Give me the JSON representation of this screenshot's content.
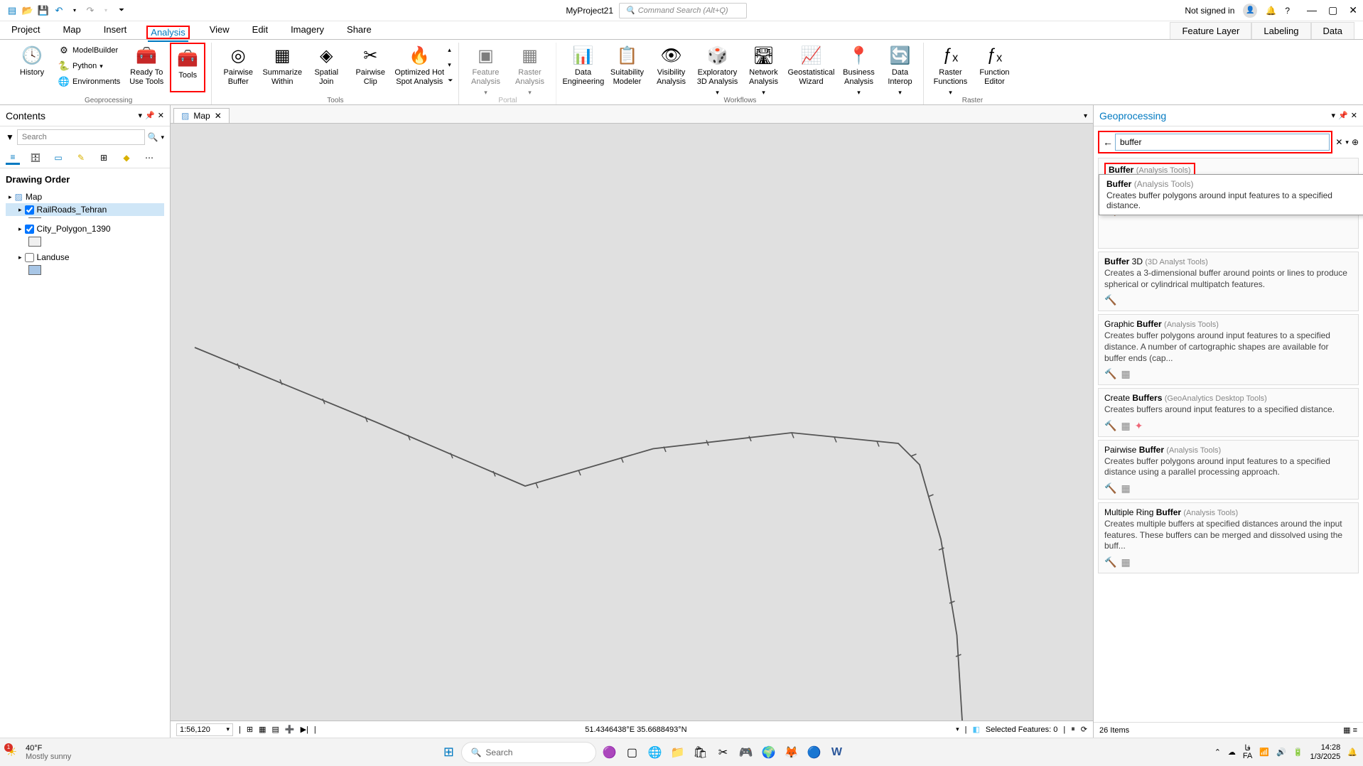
{
  "titlebar": {
    "project_name": "MyProject21",
    "cmd_search_placeholder": "Command Search (Alt+Q)",
    "signin": "Not signed in",
    "help": "?"
  },
  "ribbon_tabs": [
    "Project",
    "Map",
    "Insert",
    "Analysis",
    "View",
    "Edit",
    "Imagery",
    "Share"
  ],
  "context_tabs": [
    "Feature Layer",
    "Labeling",
    "Data"
  ],
  "ribbon": {
    "geoprocessing": {
      "label": "Geoprocessing",
      "history": "History",
      "modelbuilder": "ModelBuilder",
      "python": "Python",
      "environments": "Environments",
      "ready": "Ready To\nUse Tools",
      "tools": "Tools"
    },
    "tools": {
      "label": "Tools",
      "pairwise_buffer": "Pairwise\nBuffer",
      "summarize_within": "Summarize\nWithin",
      "spatial_join": "Spatial\nJoin",
      "pairwise_clip": "Pairwise\nClip",
      "optimized": "Optimized Hot\nSpot Analysis"
    },
    "portal": {
      "label": "Portal",
      "feature_analysis": "Feature\nAnalysis",
      "raster_analysis": "Raster\nAnalysis"
    },
    "workflows": {
      "label": "Workflows",
      "data_eng": "Data\nEngineering",
      "suitability": "Suitability\nModeler",
      "visibility": "Visibility\nAnalysis",
      "exploratory": "Exploratory\n3D Analysis",
      "network": "Network\nAnalysis",
      "geostat": "Geostatistical\nWizard",
      "business": "Business\nAnalysis",
      "interop": "Data\nInterop"
    },
    "raster": {
      "label": "Raster",
      "functions": "Raster\nFunctions",
      "editor": "Function\nEditor"
    }
  },
  "contents": {
    "title": "Contents",
    "search_placeholder": "Search",
    "drawing_order": "Drawing Order",
    "map": "Map",
    "layers": [
      {
        "name": "RailRoads_Tehran",
        "checked": true,
        "selected": true
      },
      {
        "name": "City_Polygon_1390",
        "checked": true,
        "selected": false
      },
      {
        "name": "Landuse",
        "checked": false,
        "selected": false
      }
    ]
  },
  "map": {
    "tab_label": "Map",
    "scale": "1:56,120",
    "coords": "51.4346438°E 35.6688493°N",
    "selected_features": "Selected Features: 0"
  },
  "gp": {
    "title": "Geoprocessing",
    "search_value": "buffer",
    "tooltip": {
      "name": "Buffer",
      "cat": "(Analysis Tools)",
      "desc": "Creates buffer polygons around input features to a specified distance."
    },
    "results": [
      {
        "name": "Buffer",
        "cat": "(Analysis Tools)",
        "desc": "Creates buffer polygons around input features to a specified distance.",
        "highlight": true
      },
      {
        "name": "Buffer 3D",
        "prefix": "Buffer",
        "suffix": " 3D",
        "cat": "(3D Analyst Tools)",
        "desc": "Creates a 3-dimensional buffer around points or lines to produce spherical or cylindrical multipatch features."
      },
      {
        "name": "Graphic Buffer",
        "prefix": "Graphic ",
        "suffix": "Buffer",
        "cat": "(Analysis Tools)",
        "desc": "Creates buffer polygons around input features to a specified distance. A number of cartographic shapes are available for buffer ends (cap..."
      },
      {
        "name": "Create Buffers",
        "prefix": "Create ",
        "suffix": "Buffers",
        "cat": "(GeoAnalytics Desktop Tools)",
        "desc": "Creates buffers around input features to a specified distance."
      },
      {
        "name": "Pairwise Buffer",
        "prefix": "Pairwise ",
        "suffix": "Buffer",
        "cat": "(Analysis Tools)",
        "desc": "Creates buffer polygons around input features to a specified distance using a parallel processing approach."
      },
      {
        "name": "Multiple Ring Buffer",
        "prefix": "Multiple Ring ",
        "suffix": "Buffer",
        "cat": "(Analysis Tools)",
        "desc": "Creates multiple buffers at specified distances around the input features. These buffers can be merged and dissolved using the buff..."
      }
    ],
    "footer_count": "26 Items"
  },
  "taskbar": {
    "weather_temp": "40°F",
    "weather_desc": "Mostly sunny",
    "weather_badge": "1",
    "search": "Search",
    "lang1": "فا",
    "lang2": "FA",
    "time": "14:28",
    "date": "1/3/2025"
  }
}
